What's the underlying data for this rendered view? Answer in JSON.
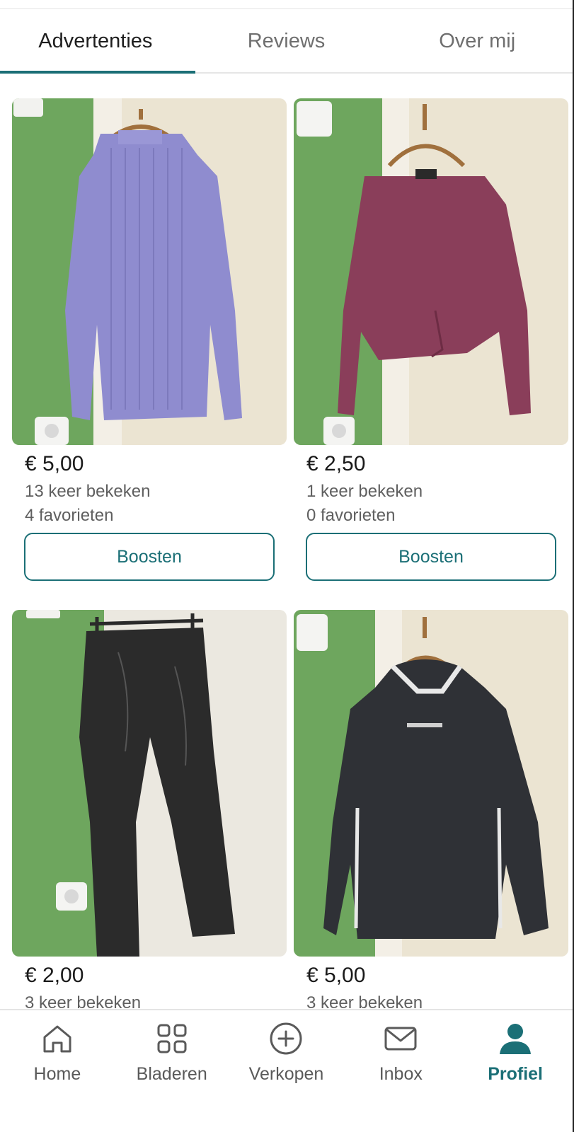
{
  "tabs": [
    {
      "label": "Advertenties",
      "active": true
    },
    {
      "label": "Reviews",
      "active": false
    },
    {
      "label": "Over mij",
      "active": false
    }
  ],
  "listings": [
    {
      "price": "€ 5,00",
      "views": "13 keer bekeken",
      "favorites": "4 favorieten",
      "button": "Boosten",
      "image": "lavender-ribbed-top"
    },
    {
      "price": "€ 2,50",
      "views": "1 keer bekeken",
      "favorites": "0 favorieten",
      "button": "Boosten",
      "image": "burgundy-ribbed-top"
    },
    {
      "price": "€ 2,00",
      "views": "3 keer bekeken",
      "image": "black-leather-leggings"
    },
    {
      "price": "€ 5,00",
      "views": "3 keer bekeken",
      "image": "black-hoodie"
    }
  ],
  "nav": [
    {
      "label": "Home",
      "icon": "home-icon",
      "active": false
    },
    {
      "label": "Bladeren",
      "icon": "grid-icon",
      "active": false
    },
    {
      "label": "Verkopen",
      "icon": "plus-circle-icon",
      "active": false
    },
    {
      "label": "Inbox",
      "icon": "mail-icon",
      "active": false
    },
    {
      "label": "Profiel",
      "icon": "person-icon",
      "active": true
    }
  ],
  "colors": {
    "accent": "#1b6f76",
    "wall_green": "#6aa55c",
    "door_white": "#ece7dc"
  }
}
